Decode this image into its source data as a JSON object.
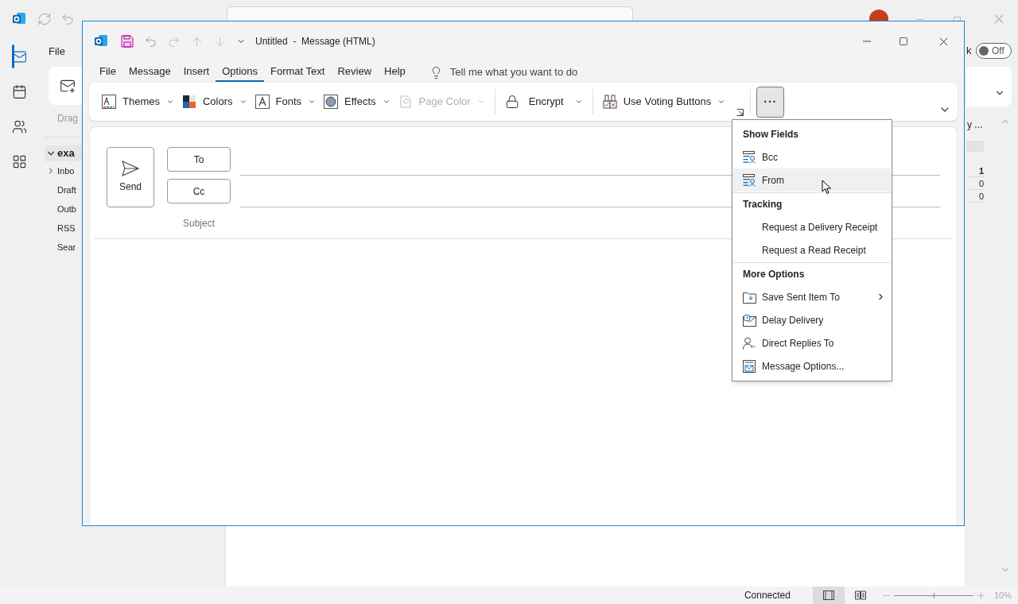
{
  "main_window": {
    "ribbon_tab": "File",
    "nav": [
      {
        "kind": "mail",
        "selected": true
      },
      {
        "kind": "calendar",
        "selected": false
      },
      {
        "kind": "people",
        "selected": false
      },
      {
        "kind": "apps",
        "selected": false
      }
    ],
    "toggle": {
      "label": "k",
      "state": "Off",
      "on": false
    },
    "folder_pane": {
      "header": "Drag",
      "account": {
        "name": "exa",
        "expanded": true
      },
      "folders": [
        {
          "name": "Inbo",
          "expandable": true
        },
        {
          "name": "Draft",
          "expandable": false
        },
        {
          "name": "Outb",
          "expandable": false
        },
        {
          "name": "RSS",
          "expandable": false
        },
        {
          "name": "Sear",
          "expandable": false
        }
      ]
    },
    "message_list": {
      "heading": "y ...",
      "counts": [
        {
          "value": "1",
          "unread": true
        },
        {
          "value": "0",
          "unread": false
        },
        {
          "value": "0",
          "unread": false
        }
      ]
    },
    "status_bar": {
      "status": "Connected",
      "views": [
        {
          "kind": "normal",
          "selected": true
        },
        {
          "kind": "reading",
          "selected": false
        }
      ],
      "zoom_slider": {
        "level": 0.5
      },
      "zoom": "10%"
    }
  },
  "compose_window": {
    "title": "Untitled  -  Message (HTML)",
    "tabs": [
      {
        "label": "File",
        "selected": false
      },
      {
        "label": "Message",
        "selected": false
      },
      {
        "label": "Insert",
        "selected": false
      },
      {
        "label": "Options",
        "selected": true
      },
      {
        "label": "Format Text",
        "selected": false
      },
      {
        "label": "Review",
        "selected": false
      },
      {
        "label": "Help",
        "selected": false
      }
    ],
    "tell_me": "Tell me what you want to do",
    "ribbon": [
      {
        "label": "Themes",
        "kind": "themes",
        "disabled": false,
        "separator_after": false
      },
      {
        "label": "Colors",
        "kind": "colors",
        "disabled": false,
        "separator_after": false
      },
      {
        "label": "Fonts",
        "kind": "fonts",
        "disabled": false,
        "separator_after": false
      },
      {
        "label": "Effects",
        "kind": "effects",
        "disabled": false,
        "separator_after": false
      },
      {
        "label": "Page Color",
        "kind": "page_color",
        "disabled": true,
        "separator_after": true
      },
      {
        "label": "Encrypt",
        "kind": "encrypt",
        "disabled": false,
        "separator_after": true
      },
      {
        "label": "Use Voting Buttons",
        "kind": "voting",
        "disabled": false,
        "separator_after": false
      }
    ],
    "more_button": {
      "label": "···",
      "pressed": true
    },
    "compose": {
      "send": "Send",
      "to": "To",
      "cc": "Cc",
      "subject": "Subject"
    },
    "menu": {
      "sections": [
        {
          "heading": "Show Fields",
          "items": [
            {
              "label": "Bcc",
              "kind": "field",
              "highlighted": false,
              "submenu": false
            },
            {
              "label": "From",
              "kind": "field",
              "highlighted": true,
              "submenu": false
            }
          ]
        },
        {
          "heading": "Tracking",
          "items": [
            {
              "label": "Request a Delivery Receipt",
              "kind": "none",
              "highlighted": false,
              "submenu": false
            },
            {
              "label": "Request a Read Receipt",
              "kind": "none",
              "highlighted": false,
              "submenu": false
            }
          ]
        },
        {
          "heading": "More Options",
          "items": [
            {
              "label": "Save Sent Item To",
              "kind": "folder",
              "highlighted": false,
              "submenu": true
            },
            {
              "label": "Delay Delivery",
              "kind": "delay",
              "highlighted": false,
              "submenu": false
            },
            {
              "label": "Direct Replies To",
              "kind": "replies",
              "highlighted": false,
              "submenu": false
            },
            {
              "label": "Message Options...",
              "kind": "options",
              "highlighted": false,
              "submenu": false
            }
          ]
        }
      ]
    }
  }
}
